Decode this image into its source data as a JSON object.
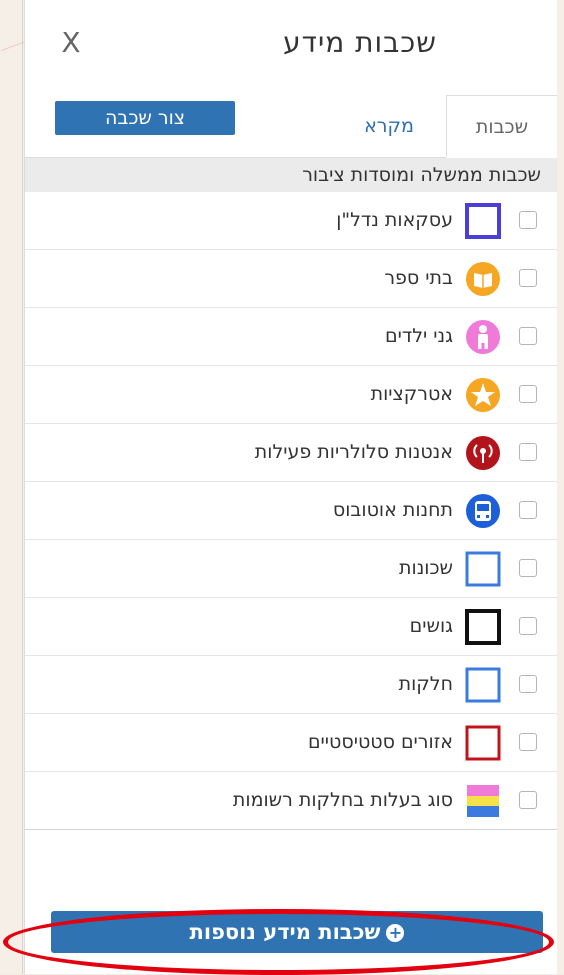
{
  "panel": {
    "title": "שכבות מידע",
    "close_glyph": "X"
  },
  "tabs": {
    "layers": "שכבות",
    "legend": "מקרא",
    "draw_layer": "צור שכבה"
  },
  "group": {
    "title": "שכבות ממשלה ומוסדות ציבור"
  },
  "layers": [
    {
      "label": "עסקאות נדל\"ן",
      "icon": "square-outline-icon",
      "color": "#4b3fd6",
      "checked": false
    },
    {
      "label": "בתי ספר",
      "icon": "book-icon",
      "color": "#f5a623",
      "checked": false
    },
    {
      "label": "גני ילדים",
      "icon": "child-icon",
      "color": "#f07ad8",
      "checked": false
    },
    {
      "label": "אטרקציות",
      "icon": "star-icon",
      "color": "#f5a623",
      "checked": false
    },
    {
      "label": "אנטנות סלולריות פעילות",
      "icon": "antenna-icon",
      "color": "#b3131b",
      "checked": false
    },
    {
      "label": "תחנות אוטובוס",
      "icon": "bus-icon",
      "color": "#1d5fd8",
      "checked": false
    },
    {
      "label": "שכונות",
      "icon": "square-outline-icon",
      "color": "#3b7be0",
      "checked": false
    },
    {
      "label": "גושים",
      "icon": "square-outline-icon",
      "color": "#111111",
      "checked": false
    },
    {
      "label": "חלקות",
      "icon": "square-outline-icon",
      "color": "#3b7be0",
      "checked": false
    },
    {
      "label": "אזורים סטטיסטיים",
      "icon": "square-outline-icon",
      "color": "#c0141c",
      "checked": false
    },
    {
      "label": "סוג בעלות בחלקות רשומות",
      "icon": "striped-square-icon",
      "colors": [
        "#f07ad8",
        "#f5e14a",
        "#3b7be0"
      ],
      "checked": false
    }
  ],
  "footer": {
    "more_layers_label": "שכבות מידע נוספות"
  }
}
